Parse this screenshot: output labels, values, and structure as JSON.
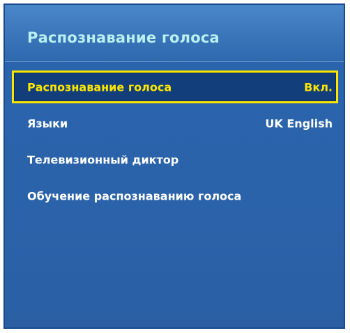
{
  "menu": {
    "title": "Распознавание голоса",
    "items": [
      {
        "label": "Распознавание голоса",
        "value": "Вкл."
      },
      {
        "label": "Языки",
        "value": "UK English"
      },
      {
        "label": "Телевизионный диктор",
        "value": ""
      },
      {
        "label": "Обучение распознаванию голоса",
        "value": ""
      }
    ],
    "selected_index": 0
  },
  "colors": {
    "panel_background": "#2b63aa",
    "header_background": "#3a75b9",
    "title_text": "#b9f0f0",
    "item_text": "#ffffff",
    "selection_highlight": "#ffe600",
    "selected_item_background": "#123f7c"
  }
}
